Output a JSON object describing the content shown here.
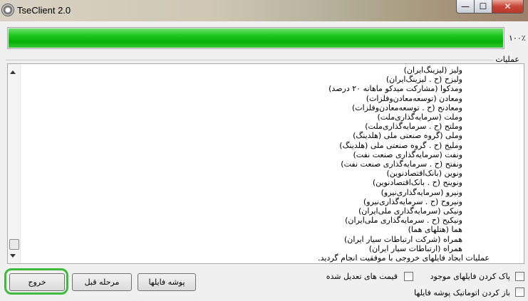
{
  "window": {
    "title": "TseClient 2.0",
    "icon": "app-gear-icon",
    "controls": {
      "minimize": "—",
      "maximize": "☐",
      "close": "✕"
    }
  },
  "progress": {
    "value": 1.0,
    "label": "۱۰۰٪"
  },
  "operations": {
    "group_label": "عملیات",
    "lines": [
      "ولیز (لیزینگ‌ایران)",
      "ولیزح (ح . لیزینگ‌ایران)",
      "ومدکوا (مشارکت میدکو ماهانه ۲۰ درصد)",
      "ومعادن (توسعه‌معادن‌وفلزات)",
      "ومعادنح (ح . توسعه‌معادن‌وفلزات)",
      "وملت (سرمایه‌گذاری‌ملت)",
      "وملتح (ح . سرمایه‌گذاری‌ملت)",
      "وملی (گروه صنعتی ملی (هلدینگ)",
      "وملیح (ح . گروه صنعتی ملی (هلدینگ)",
      "ونفت (سرمایه‌گذاری صنعت نفت)",
      "ونفتح (ح . سرمایه‌گذاری صنعت نفت)",
      "ونوین (بانک‌اقتصادنوین)",
      "ونوینح (ح . بانک‌اقتصادنوین)",
      "ونیرو (سرمایه‌گذاری‌نیرو)",
      "ونیروح (ح . سرمایه‌گذاری‌نیرو)",
      "ونیکی (سرمایه‌گذاری ملی‌ایران)",
      "ونیکیح (ح . سرمایه‌گذاری ملی‌ایران)",
      "هما (هتلهای هما)",
      "همراه (شرکت ارتباطات سیار ایران)",
      "همراه (ارتباطات سیار ایران)",
      "عملیات ایجاد فایلهای خروجی با موفقیت انجام گردید."
    ]
  },
  "buttons": {
    "exit": "خروج",
    "previous_step": "مرحله قبل",
    "output_folder": "پوشه فایلها"
  },
  "checkboxes": {
    "clear_existing": {
      "label": "پاک کردن فایلهای موجود",
      "checked": false
    },
    "adjusted_prices": {
      "label": "قیمت های تعدیل شده",
      "checked": false
    },
    "auto_open_folder": {
      "label": "باز کردن اتوماتیک پوشه فایلها",
      "checked": false
    }
  },
  "colors": {
    "progress_fill": "#06b006",
    "highlight_ring": "#3dbb3d"
  }
}
